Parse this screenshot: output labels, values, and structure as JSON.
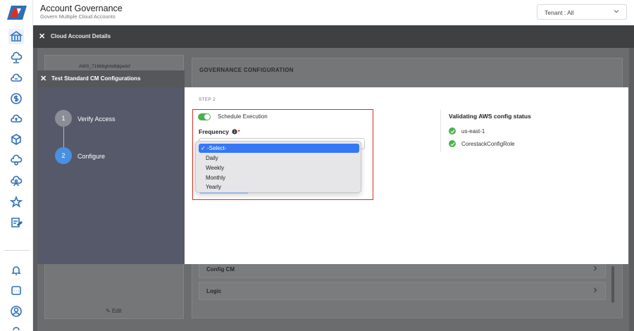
{
  "header": {
    "title": "Account Governance",
    "subtitle": "Govern Multiple Cloud Accounts",
    "tenant_label": "Tenant : All"
  },
  "sidebar": {
    "icons": [
      "bank-icon",
      "cloud-network-icon",
      "cloud-sync-icon",
      "dollar-icon",
      "cloud-upload-icon",
      "cube-icon",
      "cloud-gear-icon",
      "cloud-user-icon",
      "star-icon",
      "report-icon",
      "bell-icon",
      "chat-icon",
      "user-circle-icon",
      "more-icon"
    ]
  },
  "background_drawer": {
    "title": "Cloud Account Details",
    "provider": "aws",
    "account_id": "AWS_71666ghhdhjkjedxf",
    "edit_label": "Edit",
    "section_title": "GOVERNANCE CONFIGURATION",
    "accordion_items": [
      "Config CM",
      "Logic"
    ]
  },
  "modal": {
    "title": "Test Standard CM Configurations",
    "steps": [
      {
        "number": "1",
        "label": "Verify Access",
        "active": false
      },
      {
        "number": "2",
        "label": "Configure",
        "active": true
      }
    ],
    "step_caption": "STEP 2",
    "schedule_toggle_label": "Schedule Execution",
    "schedule_enabled": true,
    "frequency_label": "Frequency",
    "frequency_required_mark": "*",
    "frequency_options": [
      "-Select-",
      "Daily",
      "Weekly",
      "Monthly",
      "Yearly"
    ],
    "frequency_selected": "-Select-",
    "selected_checkmark": "✓",
    "validation": {
      "title": "Validating AWS config status",
      "items": [
        "us-east-1",
        "CorestackConfigRole"
      ]
    }
  },
  "colors": {
    "accent": "#4a90e2",
    "success": "#4caf50",
    "highlight_border": "#d93025",
    "rail_icon": "#2f6fb6"
  }
}
